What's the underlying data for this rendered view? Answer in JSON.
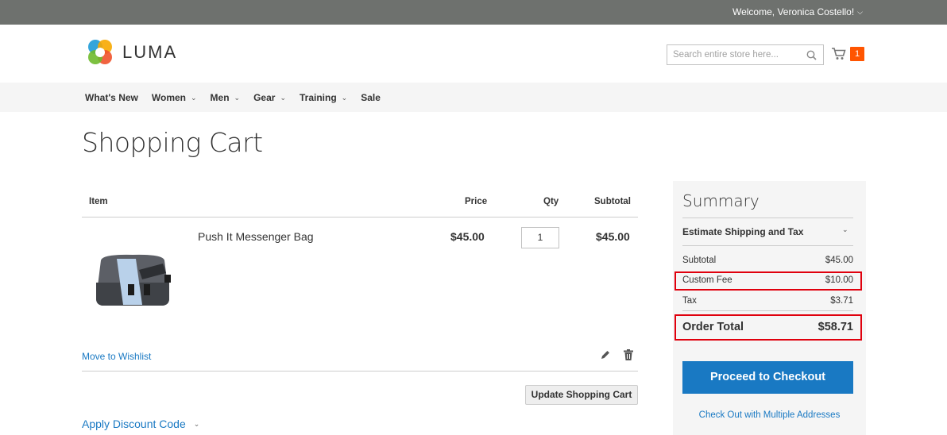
{
  "topbar": {
    "welcome": "Welcome, Veronica Costello!",
    "welcome_icon": "chevron-down-icon"
  },
  "header": {
    "logo_text": "LUMA",
    "search_placeholder": "Search entire store here...",
    "search_icon": "search-icon",
    "cart_icon": "cart-icon",
    "cart_count": "1"
  },
  "nav": {
    "items": [
      {
        "label": "What's New",
        "has_dropdown": false
      },
      {
        "label": "Women",
        "has_dropdown": true
      },
      {
        "label": "Men",
        "has_dropdown": true
      },
      {
        "label": "Gear",
        "has_dropdown": true
      },
      {
        "label": "Training",
        "has_dropdown": true
      },
      {
        "label": "Sale",
        "has_dropdown": false
      }
    ]
  },
  "page": {
    "title": "Shopping Cart"
  },
  "cart": {
    "headers": {
      "item": "Item",
      "price": "Price",
      "qty": "Qty",
      "subtotal": "Subtotal"
    },
    "item": {
      "name": "Push It Messenger Bag",
      "price": "$45.00",
      "qty": "1",
      "subtotal": "$45.00",
      "move_to_wishlist": "Move to Wishlist",
      "edit_icon": "pencil-icon",
      "delete_icon": "trash-icon"
    },
    "update_button": "Update Shopping Cart",
    "discount": "Apply Discount Code"
  },
  "summary": {
    "title": "Summary",
    "estimate": "Estimate Shipping and Tax",
    "rows": {
      "subtotal": {
        "label": "Subtotal",
        "value": "$45.00"
      },
      "custom_fee": {
        "label": "Custom Fee",
        "value": "$10.00"
      },
      "tax": {
        "label": "Tax",
        "value": "$3.71"
      }
    },
    "order_total": {
      "label": "Order Total",
      "value": "$58.71"
    },
    "checkout_button": "Proceed to Checkout",
    "multi_address": "Check Out with Multiple Addresses"
  },
  "colors": {
    "accent": "#1979c3",
    "highlight": "#e0000d",
    "cart_badge": "#ff5501",
    "topbar": "#6e716e"
  }
}
